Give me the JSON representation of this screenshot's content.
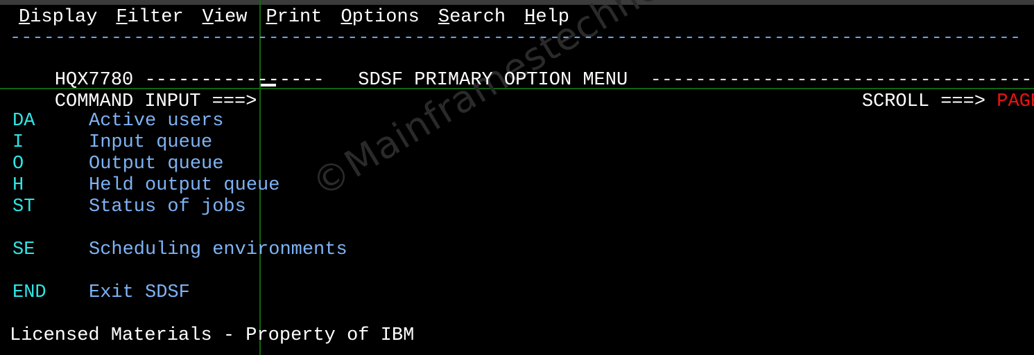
{
  "window": {
    "title_strip_color": "#3b3b3b",
    "background": "#000000",
    "guide_line_color": "#116611"
  },
  "menubar": {
    "items": [
      {
        "label": "Display",
        "mnemonic": "D",
        "rest": "isplay"
      },
      {
        "label": "Filter",
        "mnemonic": "F",
        "rest": "ilter"
      },
      {
        "label": "View",
        "mnemonic": "V",
        "rest": "iew"
      },
      {
        "label": "Print",
        "mnemonic": "P",
        "rest": "rint"
      },
      {
        "label": "Options",
        "mnemonic": "O",
        "rest": "ptions"
      },
      {
        "label": "Search",
        "mnemonic": "S",
        "rest": "earch"
      },
      {
        "label": "Help",
        "mnemonic": "H",
        "rest": "elp"
      }
    ]
  },
  "separator": {
    "blue_dashes": "------------------------------------------------------------------------------------------",
    "color": "#6f9fe0"
  },
  "header": {
    "product_id": "HQX7780",
    "left_dashes": "----------------",
    "title": "SDSF PRIMARY OPTION MENU",
    "right_dashes": "--------------------------------------------------"
  },
  "command_line": {
    "prompt": "COMMAND INPUT ===>",
    "value": "",
    "cursor": "_",
    "scroll_label": "SCROLL ===>",
    "scroll_value": "PAGE",
    "scroll_value_color": "#ee1111"
  },
  "options": [
    {
      "code": "DA",
      "desc": "Active users",
      "blank_after": false
    },
    {
      "code": "I",
      "desc": "Input queue",
      "blank_after": false
    },
    {
      "code": "O",
      "desc": "Output queue",
      "blank_after": false
    },
    {
      "code": "H",
      "desc": "Held output queue",
      "blank_after": false
    },
    {
      "code": "ST",
      "desc": "Status of jobs",
      "blank_after": true
    },
    {
      "code": "SE",
      "desc": "Scheduling environments",
      "blank_after": true
    },
    {
      "code": "END",
      "desc": "Exit SDSF",
      "blank_after": true
    }
  ],
  "footer": {
    "text": "Licensed Materials - Property of IBM"
  },
  "watermark": {
    "text": "©Mainframestechhelp",
    "color": "#2a2a2a"
  },
  "colors": {
    "option_code": "#2ee6e6",
    "option_desc": "#7eb3f5",
    "plain_text": "#ffffff"
  }
}
